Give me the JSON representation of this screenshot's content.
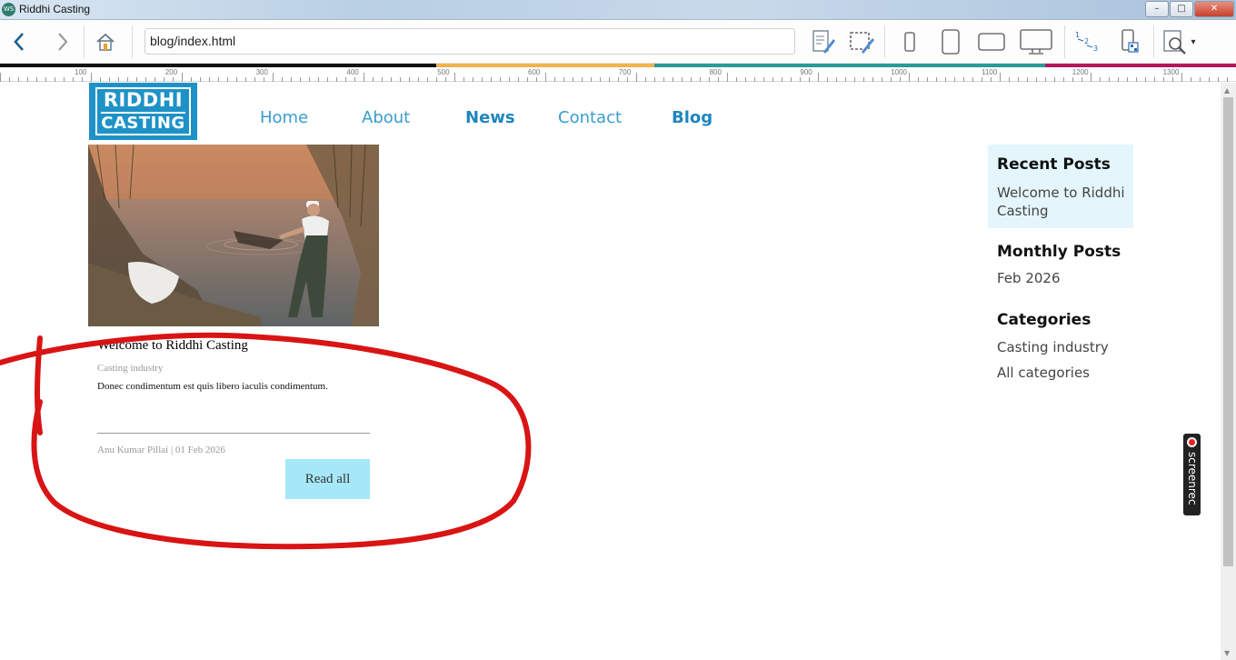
{
  "window": {
    "title": "Riddhi Casting",
    "app_icon_text": "WS",
    "minimize_glyph": "–",
    "maximize_glyph": "□",
    "close_glyph": "✕"
  },
  "toolbar": {
    "url": "blog/index.html",
    "icons": [
      "back-arrow-icon",
      "forward-arrow-icon",
      "home-icon",
      "edit-page-icon",
      "select-edit-icon",
      "phone-portrait-icon",
      "tablet-portrait-icon",
      "tablet-landscape-icon",
      "desktop-icon",
      "numbered-steps-icon",
      "mobile-qr-icon",
      "preview-zoom-icon"
    ],
    "dropdown_glyph": "▾"
  },
  "ruler": {
    "labels": [
      "100",
      "200",
      "300",
      "400",
      "500",
      "600",
      "700",
      "800",
      "900",
      "1000",
      "1100",
      "1200",
      "1300"
    ]
  },
  "strip_colors": [
    "#111111",
    "#f1b44c",
    "#2a9a9a",
    "#b3185e"
  ],
  "site": {
    "logo_line1": "RIDDHI",
    "logo_line2": "CASTING",
    "nav": [
      "Home",
      "About",
      "News",
      "Contact",
      "Blog"
    ]
  },
  "post": {
    "title": "Welcome to Riddhi Casting",
    "category": "Casting industry",
    "excerpt": "Donec condimentum est quis libero iaculis condimentum.",
    "meta": "Anu Kumar Pillai | 01 Feb 2026",
    "button": "Read all"
  },
  "sidebar": {
    "recent_heading": "Recent Posts",
    "recent_item": "Welcome to Riddhi Casting",
    "monthly_heading": "Monthly Posts",
    "monthly_item": "Feb 2026",
    "categories_heading": "Categories",
    "category_items": [
      "Casting industry",
      "All categories"
    ]
  },
  "overlay": {
    "screenrec_label": "screenrec"
  },
  "colors": {
    "brand_blue": "#1e92c7",
    "nav_blue": "#3a9dcf",
    "button_cyan": "#a6e8f7",
    "sidebar_bg": "#e4f6fc",
    "annotation_red": "#d81414"
  }
}
